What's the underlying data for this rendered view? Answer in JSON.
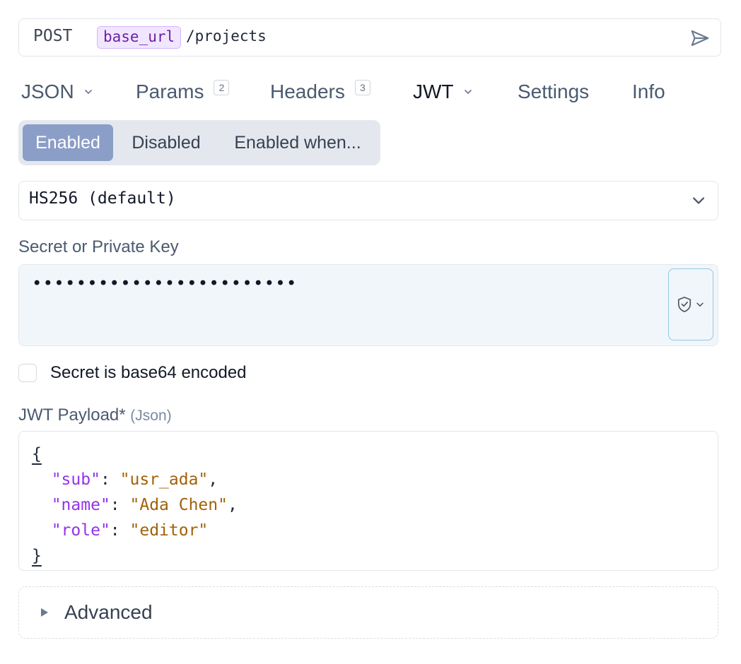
{
  "request": {
    "method": "POST",
    "variable": "base_url",
    "path": "/projects"
  },
  "tabs": [
    {
      "label": "JSON",
      "dropdown": true
    },
    {
      "label": "Params",
      "count": "2"
    },
    {
      "label": "Headers",
      "count": "3"
    },
    {
      "label": "JWT",
      "dropdown": true,
      "active": true
    },
    {
      "label": "Settings"
    },
    {
      "label": "Info"
    }
  ],
  "segmented": {
    "options": [
      "Enabled",
      "Disabled",
      "Enabled when..."
    ],
    "selected": "Enabled"
  },
  "algorithm": {
    "value": "HS256 (default)"
  },
  "secret": {
    "label": "Secret or Private Key",
    "masked_value": "••••••••••••••••••••••••"
  },
  "base64_checkbox": {
    "label": "Secret is base64 encoded",
    "checked": false
  },
  "payload": {
    "label": "JWT Payload*",
    "hint": "(Json)",
    "open_brace": "{",
    "close_brace": "}",
    "entries": [
      {
        "key": "\"sub\"",
        "value": "\"usr_ada\"",
        "trail": ","
      },
      {
        "key": "\"name\"",
        "value": "\"Ada Chen\"",
        "trail": ","
      },
      {
        "key": "\"role\"",
        "value": "\"editor\"",
        "trail": ""
      }
    ]
  },
  "advanced": {
    "label": "Advanced"
  },
  "colors": {
    "segment_active": "#8b9ec7",
    "variable_chip_bg": "#f1e6ff",
    "variable_chip_text": "#6b21a8",
    "json_key": "#9333ea",
    "json_string": "#a16207",
    "secret_bg": "#f1f6fb",
    "secret_button_border": "#90c7e6"
  },
  "icons": {
    "send": "paper-plane-icon",
    "dropdown": "chevron-down-icon",
    "secret_menu": "shield-check-icon",
    "advanced_toggle": "triangle-right-icon"
  }
}
